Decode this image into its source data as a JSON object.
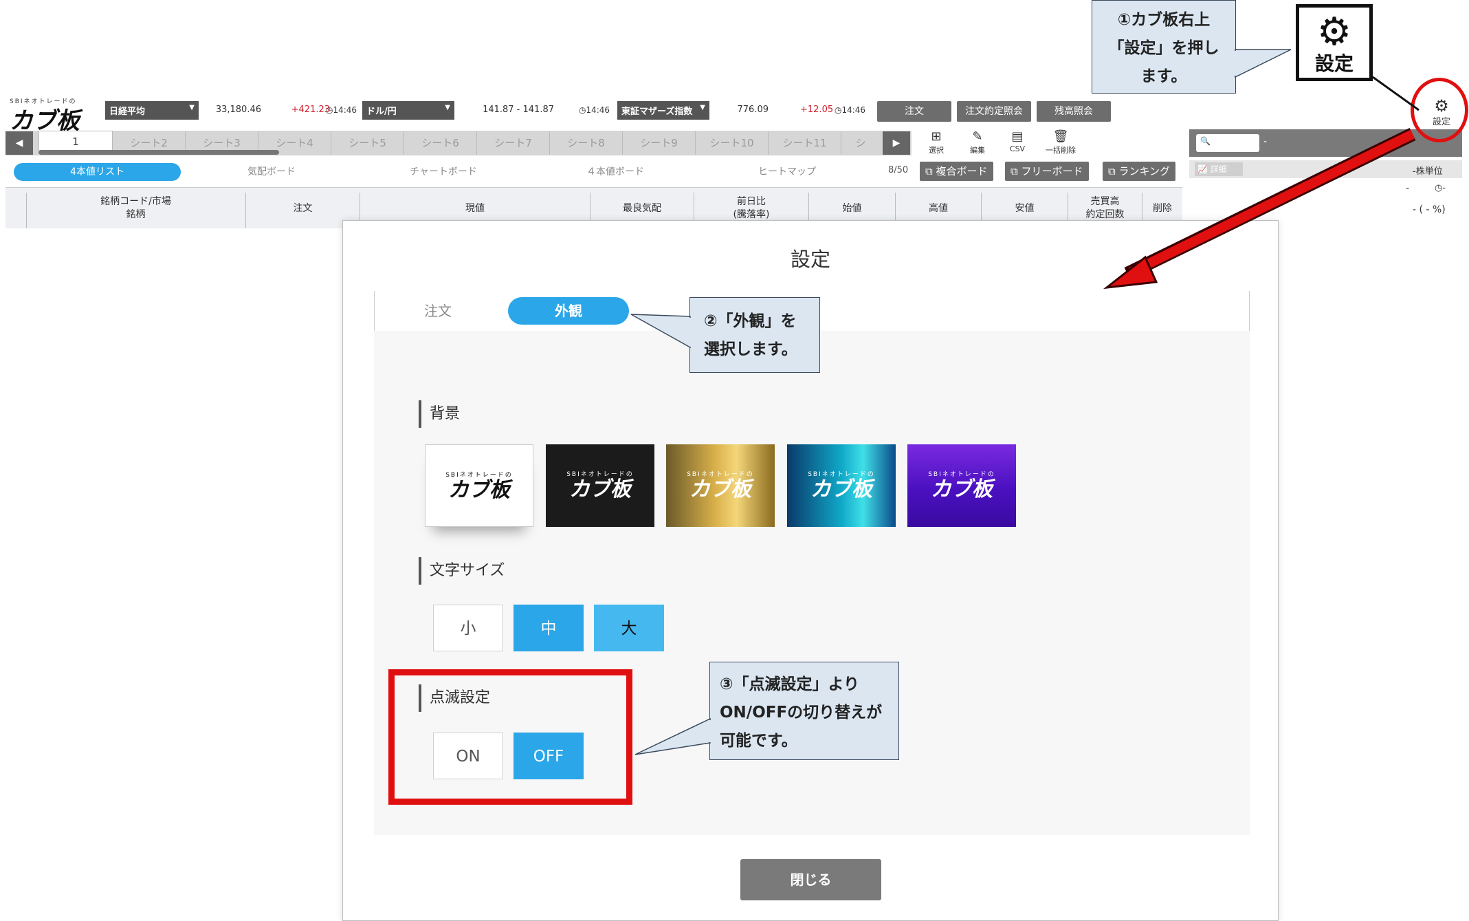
{
  "app": {
    "logo_small": "SBIネオトレードの",
    "logo_big": "カブ板",
    "tickers": [
      {
        "name": "日経平均",
        "value": "33,180.46",
        "change": "+421.23",
        "time": "14:46"
      },
      {
        "name": "ドル/円",
        "value": "141.87 - 141.87",
        "change": "",
        "time": "14:46"
      },
      {
        "name": "東証マザーズ指数",
        "value": "776.09",
        "change": "+12.05",
        "time": "14:46"
      }
    ],
    "top_buttons": [
      "注文",
      "注文約定照会",
      "残高照会"
    ],
    "settings_label": "設定",
    "sheet_tabs": [
      "1",
      "シート2",
      "シート3",
      "シート4",
      "シート5",
      "シート6",
      "シート7",
      "シート8",
      "シート9",
      "シート10",
      "シート11",
      "シ"
    ],
    "tool_icons": [
      {
        "icon": "add-box-icon",
        "label": "選択"
      },
      {
        "icon": "pencil-icon",
        "label": "編集"
      },
      {
        "icon": "csv-icon",
        "label": "CSV"
      },
      {
        "icon": "trash-icon",
        "label": "一括削除"
      }
    ],
    "sub_tabs": [
      "4本値リスト",
      "気配ボード",
      "チャートボード",
      "４本値ボード",
      "ヒートマップ"
    ],
    "counter": "8/50",
    "link_buttons": [
      "複合ボード",
      "フリーボード",
      "ランキング"
    ],
    "columns": [
      "銘柄コード/市場\n銘柄",
      "注文",
      "現値",
      "最良気配",
      "前日比\n(騰落率)",
      "始値",
      "高値",
      "安値",
      "売買高\n約定回数",
      "削除"
    ],
    "right_panel": {
      "search_placeholder": "",
      "dash": "-",
      "detail": "詳細",
      "unit": "-株単位",
      "time_dash": "-",
      "time_val": "-",
      "pct": "- ( - %)"
    }
  },
  "callouts": {
    "c1": [
      "①カブ板右上",
      "「設定」を押し",
      "ます。"
    ],
    "c2": [
      "②「外観」を",
      "選択します。"
    ],
    "c3": [
      "③「点滅設定」より",
      "ON/OFFの切り替えが",
      "可能です。"
    ]
  },
  "gear_big_label": "設定",
  "modal": {
    "title": "設定",
    "tabs": [
      "注文",
      "外観"
    ],
    "sections": {
      "background": "背景",
      "font_size": "文字サイズ",
      "blink": "点滅設定"
    },
    "backgrounds": [
      {
        "small": "SBIネオトレードの",
        "big": "カブ板"
      },
      {
        "small": "SBIネオトレードの",
        "big": "カブ板"
      },
      {
        "small": "SBIネオトレードの",
        "big": "カブ板"
      },
      {
        "small": "SBIネオトレードの",
        "big": "カブ板"
      },
      {
        "small": "SBIネオトレードの",
        "big": "カブ板"
      }
    ],
    "font_sizes": [
      "小",
      "中",
      "大"
    ],
    "blink_options": [
      "ON",
      "OFF"
    ],
    "close": "閉じる"
  },
  "colors": {
    "accent": "#2ba6e8",
    "highlight": "#e01010",
    "callout_bg": "#dbe6f1"
  }
}
